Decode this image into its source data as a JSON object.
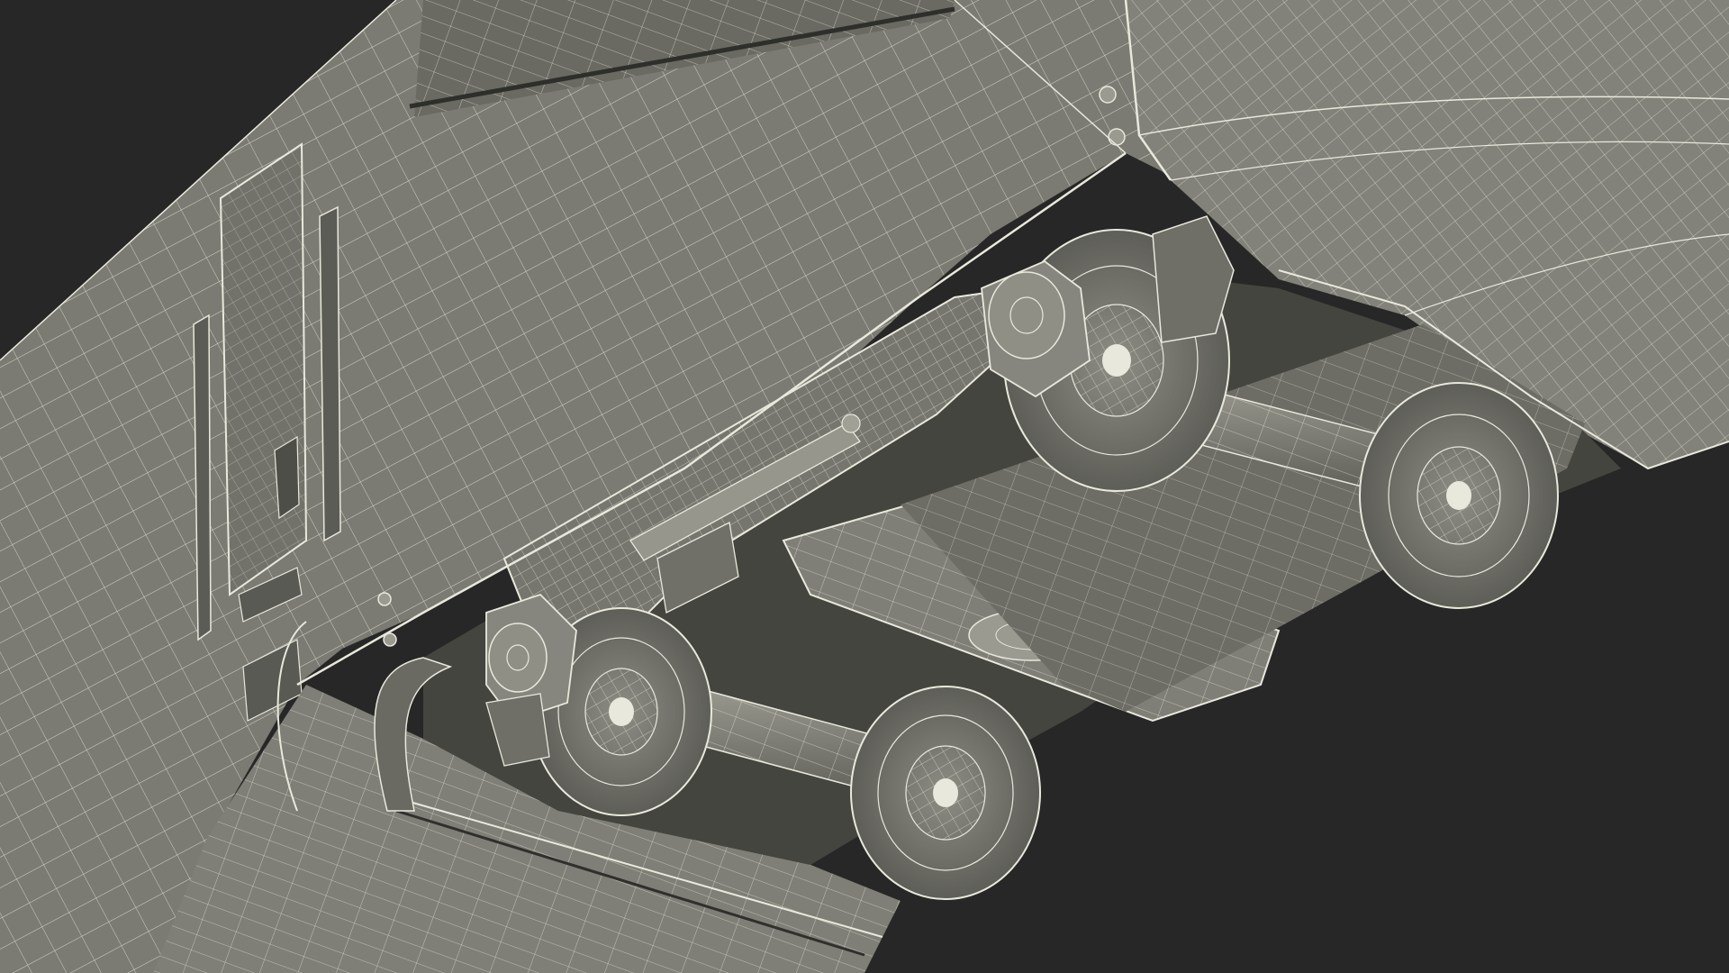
{
  "scene": {
    "subject": "wireframe-3d-render",
    "colors": {
      "background": "#272727",
      "surface": "#7a7a72",
      "surface_light": "#8a8a82",
      "surface_dark": "#4a4a45",
      "shadow": "#3a3a36",
      "wire": "#e8e8dc"
    }
  }
}
